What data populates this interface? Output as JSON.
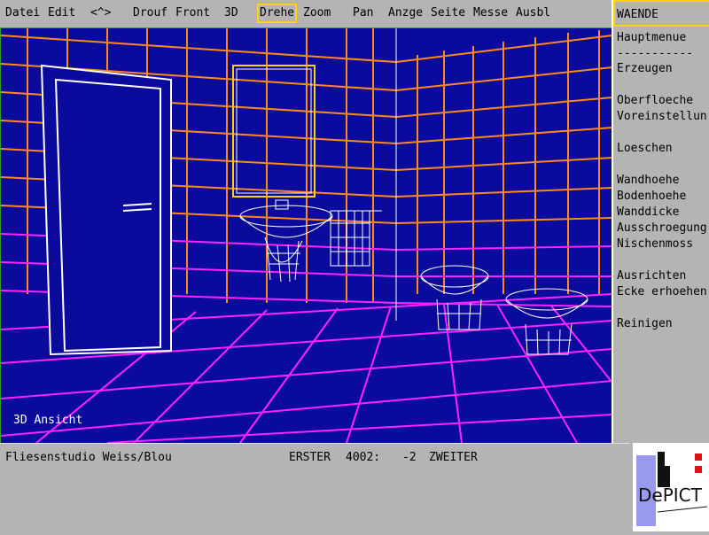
{
  "menu": {
    "items": [
      "Datei",
      "Edit",
      "<^>",
      "Drouf",
      "Front",
      "3D",
      "Drehe",
      "Zoom",
      "Pan",
      "Anzge",
      "Seite",
      "Messe",
      "Ausbl"
    ],
    "active": "Drehe"
  },
  "viewport": {
    "label": "3D Ansicht"
  },
  "sidebar": {
    "title": "WAENDE",
    "items": [
      "Hauptmenue",
      "-----------",
      "Erzeugen",
      "Oberfloeche",
      "Voreinstellun",
      "Loeschen",
      "Wandhoehe",
      "Bodenhoehe",
      "Wanddicke",
      "Ausschroegung",
      "Nischenmoss",
      "Ausrichten",
      "Ecke erhoehen",
      "Reinigen"
    ]
  },
  "status": {
    "name": "Fliesenstudio Weiss/Blou",
    "first_label": "ERSTER",
    "first_value": "4002:",
    "second_value": "-2",
    "second_label": "ZWEITER"
  },
  "logo": {
    "text": "DePICT"
  },
  "colors": {
    "viewport_bg": "#0a0a9c",
    "wall_grid": "#ff8a1a",
    "floor_grid": "#ff22ff",
    "highlight": "#ffd400",
    "wireframe": "#ffffff"
  }
}
